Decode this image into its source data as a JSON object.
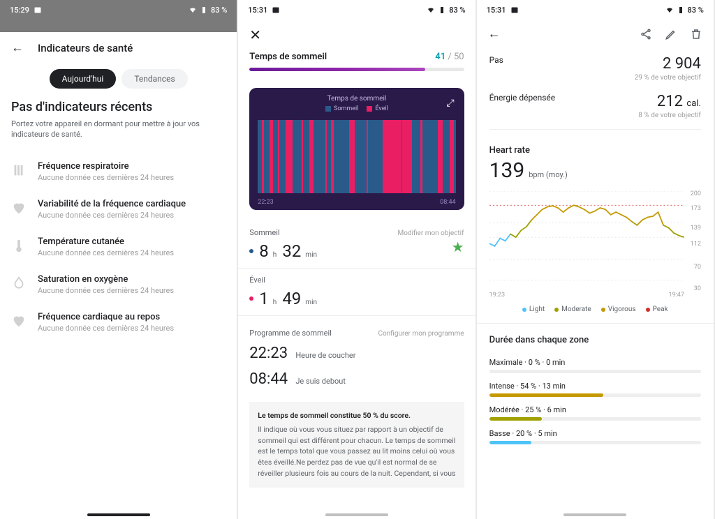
{
  "status": {
    "time1": "15:29",
    "time2": "15:31",
    "time3": "15:31",
    "battery": "83 %"
  },
  "pane1": {
    "title": "Indicateurs de santé",
    "tab_today": "Aujourd'hui",
    "tab_trends": "Tendances",
    "heading": "Pas d'indicateurs récents",
    "sub": "Portez votre appareil en dormant pour mettre à jour vos indicateurs de santé.",
    "no_data": "Aucune donnée ces dernières 24 heures",
    "metrics": {
      "resp": "Fréquence respiratoire",
      "hrv": "Variabilité de la fréquence cardiaque",
      "temp": "Température cutanée",
      "spo2": "Saturation en oxygène",
      "rhr": "Fréquence cardiaque au repos"
    }
  },
  "pane2": {
    "score_label": "Temps de sommeil",
    "score_cur": "41",
    "score_max": "/ 50",
    "score_pct": 82,
    "chart_title": "Temps de sommeil",
    "leg_sleep": "Sommeil",
    "leg_wake": "Éveil",
    "t_start": "22:23",
    "t_end": "08:44",
    "sleep_label": "Sommeil",
    "modify_goal": "Modifier mon objectif",
    "sleep_h": "8",
    "sleep_m": "32",
    "wake_label": "Éveil",
    "wake_h": "1",
    "wake_m": "49",
    "h_unit": "h",
    "m_unit": "min",
    "prog_label": "Programme de sommeil",
    "prog_link": "Configurer mon programme",
    "bed_time": "22:23",
    "bed_lbl": "Heure de coucher",
    "up_time": "08:44",
    "up_lbl": "Je suis debout",
    "info_title": "Le temps de sommeil constitue 50 % du score.",
    "info_body": "Il indique où vous vous situez par rapport à un objectif de sommeil qui est différent pour chacun. Le temps de sommeil est le temps total que vous passez au lit moins celui où vous êtes éveillé.Ne perdez pas de vue qu'il est normal de se réveiller plusieurs fois au cours de la nuit. Cependant, si vous"
  },
  "pane3": {
    "steps_lbl": "Pas",
    "steps_val": "2 904",
    "steps_goal": "29 % de votre objectif",
    "energy_lbl": "Énergie dépensée",
    "energy_val": "212",
    "energy_unit": "cal.",
    "energy_goal": "8 % de votre objectif",
    "hr_title": "Heart rate",
    "hr_val": "139",
    "hr_unit": "bpm (moy.)",
    "hr_t_start": "19:23",
    "hr_t_end": "19:47",
    "yticks": {
      "y200": "200",
      "y173": "173",
      "y139": "139",
      "y112": "112",
      "y70": "70",
      "y30": "30"
    },
    "leg_light": "Light",
    "leg_mod": "Moderate",
    "leg_vig": "Vigorous",
    "leg_peak": "Peak",
    "zone_title": "Durée dans chaque zone",
    "zones": {
      "max": {
        "label": "Maximale · 0 % · 0 min",
        "pct": 0,
        "color": "#d32f2f"
      },
      "int": {
        "label": "Intense · 54 % · 13 min",
        "pct": 54,
        "color": "#c49a00"
      },
      "mod": {
        "label": "Modérée · 25 % · 6 min",
        "pct": 25,
        "color": "#a0a000"
      },
      "bas": {
        "label": "Basse · 20 % · 5 min",
        "pct": 20,
        "color": "#4fc3f7"
      }
    }
  },
  "colors": {
    "light": "#4fc3f7",
    "moderate": "#a0a000",
    "vigorous": "#c49a00",
    "peak": "#d32f2f"
  },
  "chart_data": [
    {
      "type": "bar",
      "title": "Temps de sommeil",
      "x_range": [
        "22:23",
        "08:44"
      ],
      "series": [
        {
          "name": "Sommeil",
          "color": "#2a5a8a"
        },
        {
          "name": "Éveil",
          "color": "#e91e63"
        }
      ],
      "wake_intervals_pct": [
        [
          2,
          1.2
        ],
        [
          6,
          1.8
        ],
        [
          10,
          1
        ],
        [
          14,
          3.5
        ],
        [
          22,
          0.8
        ],
        [
          26,
          2.2
        ],
        [
          34,
          1
        ],
        [
          37,
          1.5
        ],
        [
          46,
          3
        ],
        [
          55,
          0.8
        ],
        [
          63,
          8
        ],
        [
          71,
          1.5
        ],
        [
          73,
          5
        ],
        [
          82,
          1.2
        ],
        [
          91,
          2.5
        ],
        [
          97,
          2
        ]
      ]
    },
    {
      "type": "line",
      "title": "Heart rate",
      "ylabel": "bpm",
      "ylim": [
        30,
        200
      ],
      "x_range": [
        "19:23",
        "19:47"
      ],
      "reference_lines": [
        173,
        139,
        112,
        70,
        30
      ],
      "peak_threshold": 173,
      "approx_values": [
        100,
        95,
        110,
        105,
        118,
        112,
        125,
        132,
        145,
        155,
        165,
        170,
        172,
        168,
        160,
        168,
        173,
        170,
        165,
        158,
        162,
        168,
        165,
        155,
        160,
        155,
        150,
        142,
        135,
        145,
        150,
        152,
        160,
        135,
        130,
        120,
        115,
        112
      ]
    }
  ]
}
